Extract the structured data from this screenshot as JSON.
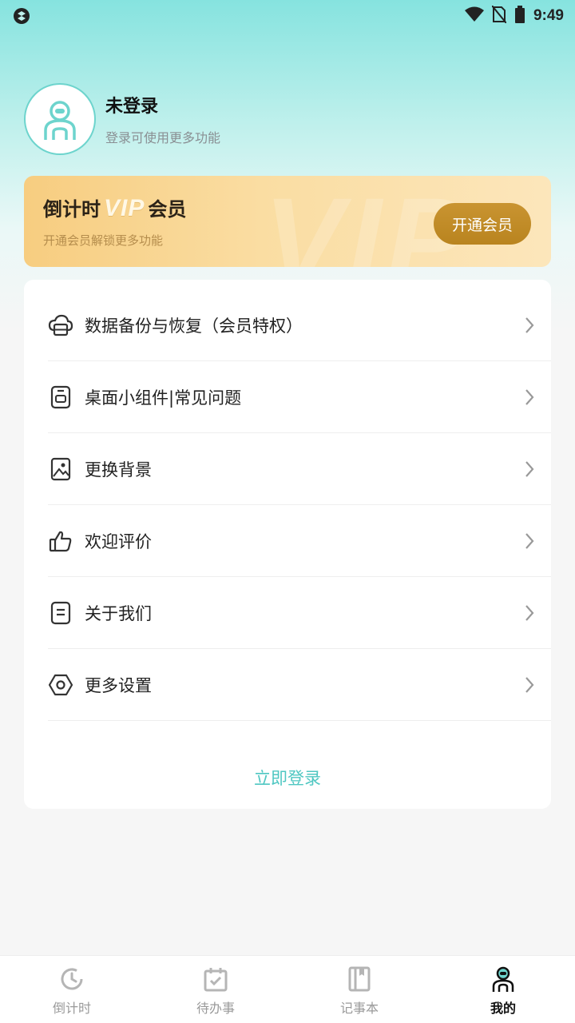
{
  "status_bar": {
    "time": "9:49"
  },
  "profile": {
    "name": "未登录",
    "subtitle": "登录可使用更多功能"
  },
  "vip": {
    "title_prefix": "倒计时",
    "title_vip": "VIP",
    "title_suffix": "会员",
    "subtitle": "开通会员解锁更多功能",
    "button_label": "开通会员",
    "watermark": "VIP",
    "colors": {
      "button": "#c08c29",
      "card": "#f8d28c"
    }
  },
  "menu": {
    "items": [
      {
        "label": "数据备份与恢复（会员特权）",
        "icon": "cloud-backup-icon"
      },
      {
        "label": "桌面小组件|常见问题",
        "icon": "widget-icon"
      },
      {
        "label": "更换背景",
        "icon": "image-icon"
      },
      {
        "label": "欢迎评价",
        "icon": "thumbs-up-icon"
      },
      {
        "label": "关于我们",
        "icon": "document-icon"
      },
      {
        "label": "更多设置",
        "icon": "settings-icon"
      }
    ],
    "login_label": "立即登录"
  },
  "bottom_nav": {
    "items": [
      {
        "label": "倒计时",
        "icon": "clock-icon",
        "active": false
      },
      {
        "label": "待办事",
        "icon": "calendar-check-icon",
        "active": false
      },
      {
        "label": "记事本",
        "icon": "notebook-icon",
        "active": false
      },
      {
        "label": "我的",
        "icon": "profile-icon",
        "active": true
      }
    ]
  },
  "colors": {
    "accent": "#4fc7c2",
    "header_gradient_top": "#86e3df"
  }
}
